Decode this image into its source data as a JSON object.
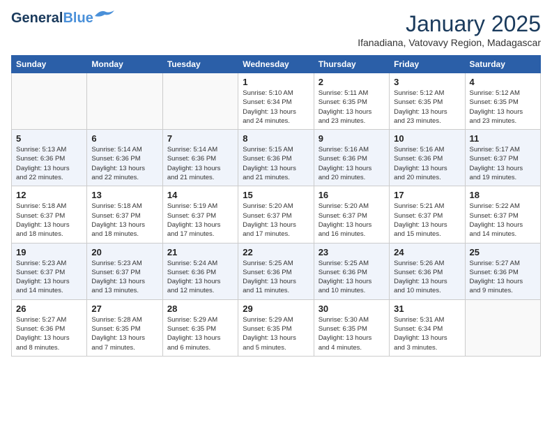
{
  "header": {
    "logo_line1": "General",
    "logo_line2": "Blue",
    "month_year": "January 2025",
    "location": "Ifanadiana, Vatovavy Region, Madagascar"
  },
  "days_of_week": [
    "Sunday",
    "Monday",
    "Tuesday",
    "Wednesday",
    "Thursday",
    "Friday",
    "Saturday"
  ],
  "weeks": [
    [
      {
        "num": "",
        "info": ""
      },
      {
        "num": "",
        "info": ""
      },
      {
        "num": "",
        "info": ""
      },
      {
        "num": "1",
        "info": "Sunrise: 5:10 AM\nSunset: 6:34 PM\nDaylight: 13 hours\nand 24 minutes."
      },
      {
        "num": "2",
        "info": "Sunrise: 5:11 AM\nSunset: 6:35 PM\nDaylight: 13 hours\nand 23 minutes."
      },
      {
        "num": "3",
        "info": "Sunrise: 5:12 AM\nSunset: 6:35 PM\nDaylight: 13 hours\nand 23 minutes."
      },
      {
        "num": "4",
        "info": "Sunrise: 5:12 AM\nSunset: 6:35 PM\nDaylight: 13 hours\nand 23 minutes."
      }
    ],
    [
      {
        "num": "5",
        "info": "Sunrise: 5:13 AM\nSunset: 6:36 PM\nDaylight: 13 hours\nand 22 minutes."
      },
      {
        "num": "6",
        "info": "Sunrise: 5:14 AM\nSunset: 6:36 PM\nDaylight: 13 hours\nand 22 minutes."
      },
      {
        "num": "7",
        "info": "Sunrise: 5:14 AM\nSunset: 6:36 PM\nDaylight: 13 hours\nand 21 minutes."
      },
      {
        "num": "8",
        "info": "Sunrise: 5:15 AM\nSunset: 6:36 PM\nDaylight: 13 hours\nand 21 minutes."
      },
      {
        "num": "9",
        "info": "Sunrise: 5:16 AM\nSunset: 6:36 PM\nDaylight: 13 hours\nand 20 minutes."
      },
      {
        "num": "10",
        "info": "Sunrise: 5:16 AM\nSunset: 6:36 PM\nDaylight: 13 hours\nand 20 minutes."
      },
      {
        "num": "11",
        "info": "Sunrise: 5:17 AM\nSunset: 6:37 PM\nDaylight: 13 hours\nand 19 minutes."
      }
    ],
    [
      {
        "num": "12",
        "info": "Sunrise: 5:18 AM\nSunset: 6:37 PM\nDaylight: 13 hours\nand 18 minutes."
      },
      {
        "num": "13",
        "info": "Sunrise: 5:18 AM\nSunset: 6:37 PM\nDaylight: 13 hours\nand 18 minutes."
      },
      {
        "num": "14",
        "info": "Sunrise: 5:19 AM\nSunset: 6:37 PM\nDaylight: 13 hours\nand 17 minutes."
      },
      {
        "num": "15",
        "info": "Sunrise: 5:20 AM\nSunset: 6:37 PM\nDaylight: 13 hours\nand 17 minutes."
      },
      {
        "num": "16",
        "info": "Sunrise: 5:20 AM\nSunset: 6:37 PM\nDaylight: 13 hours\nand 16 minutes."
      },
      {
        "num": "17",
        "info": "Sunrise: 5:21 AM\nSunset: 6:37 PM\nDaylight: 13 hours\nand 15 minutes."
      },
      {
        "num": "18",
        "info": "Sunrise: 5:22 AM\nSunset: 6:37 PM\nDaylight: 13 hours\nand 14 minutes."
      }
    ],
    [
      {
        "num": "19",
        "info": "Sunrise: 5:23 AM\nSunset: 6:37 PM\nDaylight: 13 hours\nand 14 minutes."
      },
      {
        "num": "20",
        "info": "Sunrise: 5:23 AM\nSunset: 6:37 PM\nDaylight: 13 hours\nand 13 minutes."
      },
      {
        "num": "21",
        "info": "Sunrise: 5:24 AM\nSunset: 6:36 PM\nDaylight: 13 hours\nand 12 minutes."
      },
      {
        "num": "22",
        "info": "Sunrise: 5:25 AM\nSunset: 6:36 PM\nDaylight: 13 hours\nand 11 minutes."
      },
      {
        "num": "23",
        "info": "Sunrise: 5:25 AM\nSunset: 6:36 PM\nDaylight: 13 hours\nand 10 minutes."
      },
      {
        "num": "24",
        "info": "Sunrise: 5:26 AM\nSunset: 6:36 PM\nDaylight: 13 hours\nand 10 minutes."
      },
      {
        "num": "25",
        "info": "Sunrise: 5:27 AM\nSunset: 6:36 PM\nDaylight: 13 hours\nand 9 minutes."
      }
    ],
    [
      {
        "num": "26",
        "info": "Sunrise: 5:27 AM\nSunset: 6:36 PM\nDaylight: 13 hours\nand 8 minutes."
      },
      {
        "num": "27",
        "info": "Sunrise: 5:28 AM\nSunset: 6:35 PM\nDaylight: 13 hours\nand 7 minutes."
      },
      {
        "num": "28",
        "info": "Sunrise: 5:29 AM\nSunset: 6:35 PM\nDaylight: 13 hours\nand 6 minutes."
      },
      {
        "num": "29",
        "info": "Sunrise: 5:29 AM\nSunset: 6:35 PM\nDaylight: 13 hours\nand 5 minutes."
      },
      {
        "num": "30",
        "info": "Sunrise: 5:30 AM\nSunset: 6:35 PM\nDaylight: 13 hours\nand 4 minutes."
      },
      {
        "num": "31",
        "info": "Sunrise: 5:31 AM\nSunset: 6:34 PM\nDaylight: 13 hours\nand 3 minutes."
      },
      {
        "num": "",
        "info": ""
      }
    ]
  ]
}
